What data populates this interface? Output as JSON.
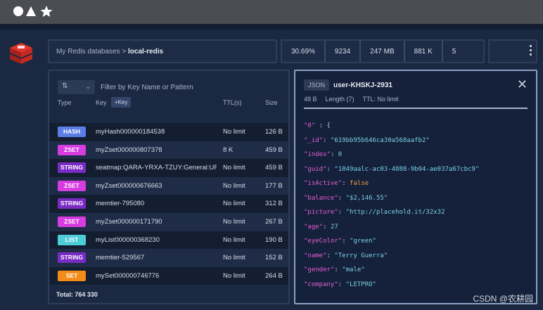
{
  "colors": {
    "HASH": "#5b7ee6",
    "ZSET": "#d63ce0",
    "STRING": "#7a2bc4",
    "LIST": "#4ecdd8",
    "SET": "#f28c18"
  },
  "header": {
    "icons": [
      "circle-icon",
      "triangle-icon",
      "star-icon"
    ]
  },
  "breadcrumb": {
    "parent": "My Redis databases",
    "separator": ">",
    "current": "local-redis"
  },
  "stats": [
    "30.69%",
    "9234",
    "247 MB",
    "881 K",
    "5"
  ],
  "keylist": {
    "filter_placeholder": "Filter by Key Name or Pattern",
    "columns": {
      "type": "Type",
      "key": "Key",
      "add_key": "+Key",
      "ttl": "TTL(s)",
      "size": "Size"
    },
    "rows": [
      {
        "type": "HASH",
        "name": "myHash000000184538",
        "ttl": "No limit",
        "size": "126 B"
      },
      {
        "type": "ZSET",
        "name": "myZset000000807378",
        "ttl": "8 K",
        "size": "459 B"
      },
      {
        "type": "STRING",
        "name": "seatmap:QARA-YRXA-TZUY:General:UF",
        "ttl": "No limit",
        "size": "459 B"
      },
      {
        "type": "ZSET",
        "name": "myZset000000676663",
        "ttl": "No limit",
        "size": "177 B"
      },
      {
        "type": "STRING",
        "name": "memtier-795080",
        "ttl": "No limit",
        "size": "312 B"
      },
      {
        "type": "ZSET",
        "name": "myZset000000171790",
        "ttl": "No limit",
        "size": "267 B"
      },
      {
        "type": "LIST",
        "name": "myList000000368230",
        "ttl": "No limit",
        "size": "190 B"
      },
      {
        "type": "STRING",
        "name": "memtier-529567",
        "ttl": "No limit",
        "size": "152 B"
      },
      {
        "type": "SET",
        "name": "mySet000000746776",
        "ttl": "No limit",
        "size": "264 B"
      }
    ],
    "total": "Total: 764 330"
  },
  "detail": {
    "type": "JSON",
    "key": "user-KHSKJ-2931",
    "size": "48 B",
    "length": "Length (7)",
    "ttl": "TTL: No limit",
    "json_lines": [
      {
        "key": "\"0\"",
        "sep": " : {",
        "value": "",
        "vtype": "p"
      },
      {
        "key": "\"_id\"",
        "sep": ": ",
        "value": "\"619bb95b646ca30a568aafb2\"",
        "vtype": "s"
      },
      {
        "key": "\"index\"",
        "sep": ": ",
        "value": "0",
        "vtype": "n"
      },
      {
        "key": "\"guid\"",
        "sep": ": ",
        "value": "\"1049aalc-ac03-4888-9b04-ae037a67cbc9\"",
        "vtype": "s"
      },
      {
        "key": "\"isActive\"",
        "sep": ": ",
        "value": "false",
        "vtype": "b"
      },
      {
        "key": "\"balance\"",
        "sep": ": ",
        "value": "\"$2,146.55\"",
        "vtype": "s"
      },
      {
        "key": "\"picture\"",
        "sep": ": ",
        "value": "\"http://placehold.it/32x32",
        "vtype": "s"
      },
      {
        "key": "\"age\"",
        "sep": ": ",
        "value": "27",
        "vtype": "n"
      },
      {
        "key": "\"eyeColor\"",
        "sep": ": ",
        "value": "\"green\"",
        "vtype": "s"
      },
      {
        "key": "\"name\"",
        "sep": ": ",
        "value": "\"Terry Guerra\"",
        "vtype": "s"
      },
      {
        "key": "\"gender\"",
        "sep": ": ",
        "value": "\"male\"",
        "vtype": "s"
      },
      {
        "key": "\"company\"",
        "sep": ": ",
        "value": "\"LETPRO\"",
        "vtype": "s"
      }
    ]
  },
  "watermark": "CSDN @农耕园"
}
